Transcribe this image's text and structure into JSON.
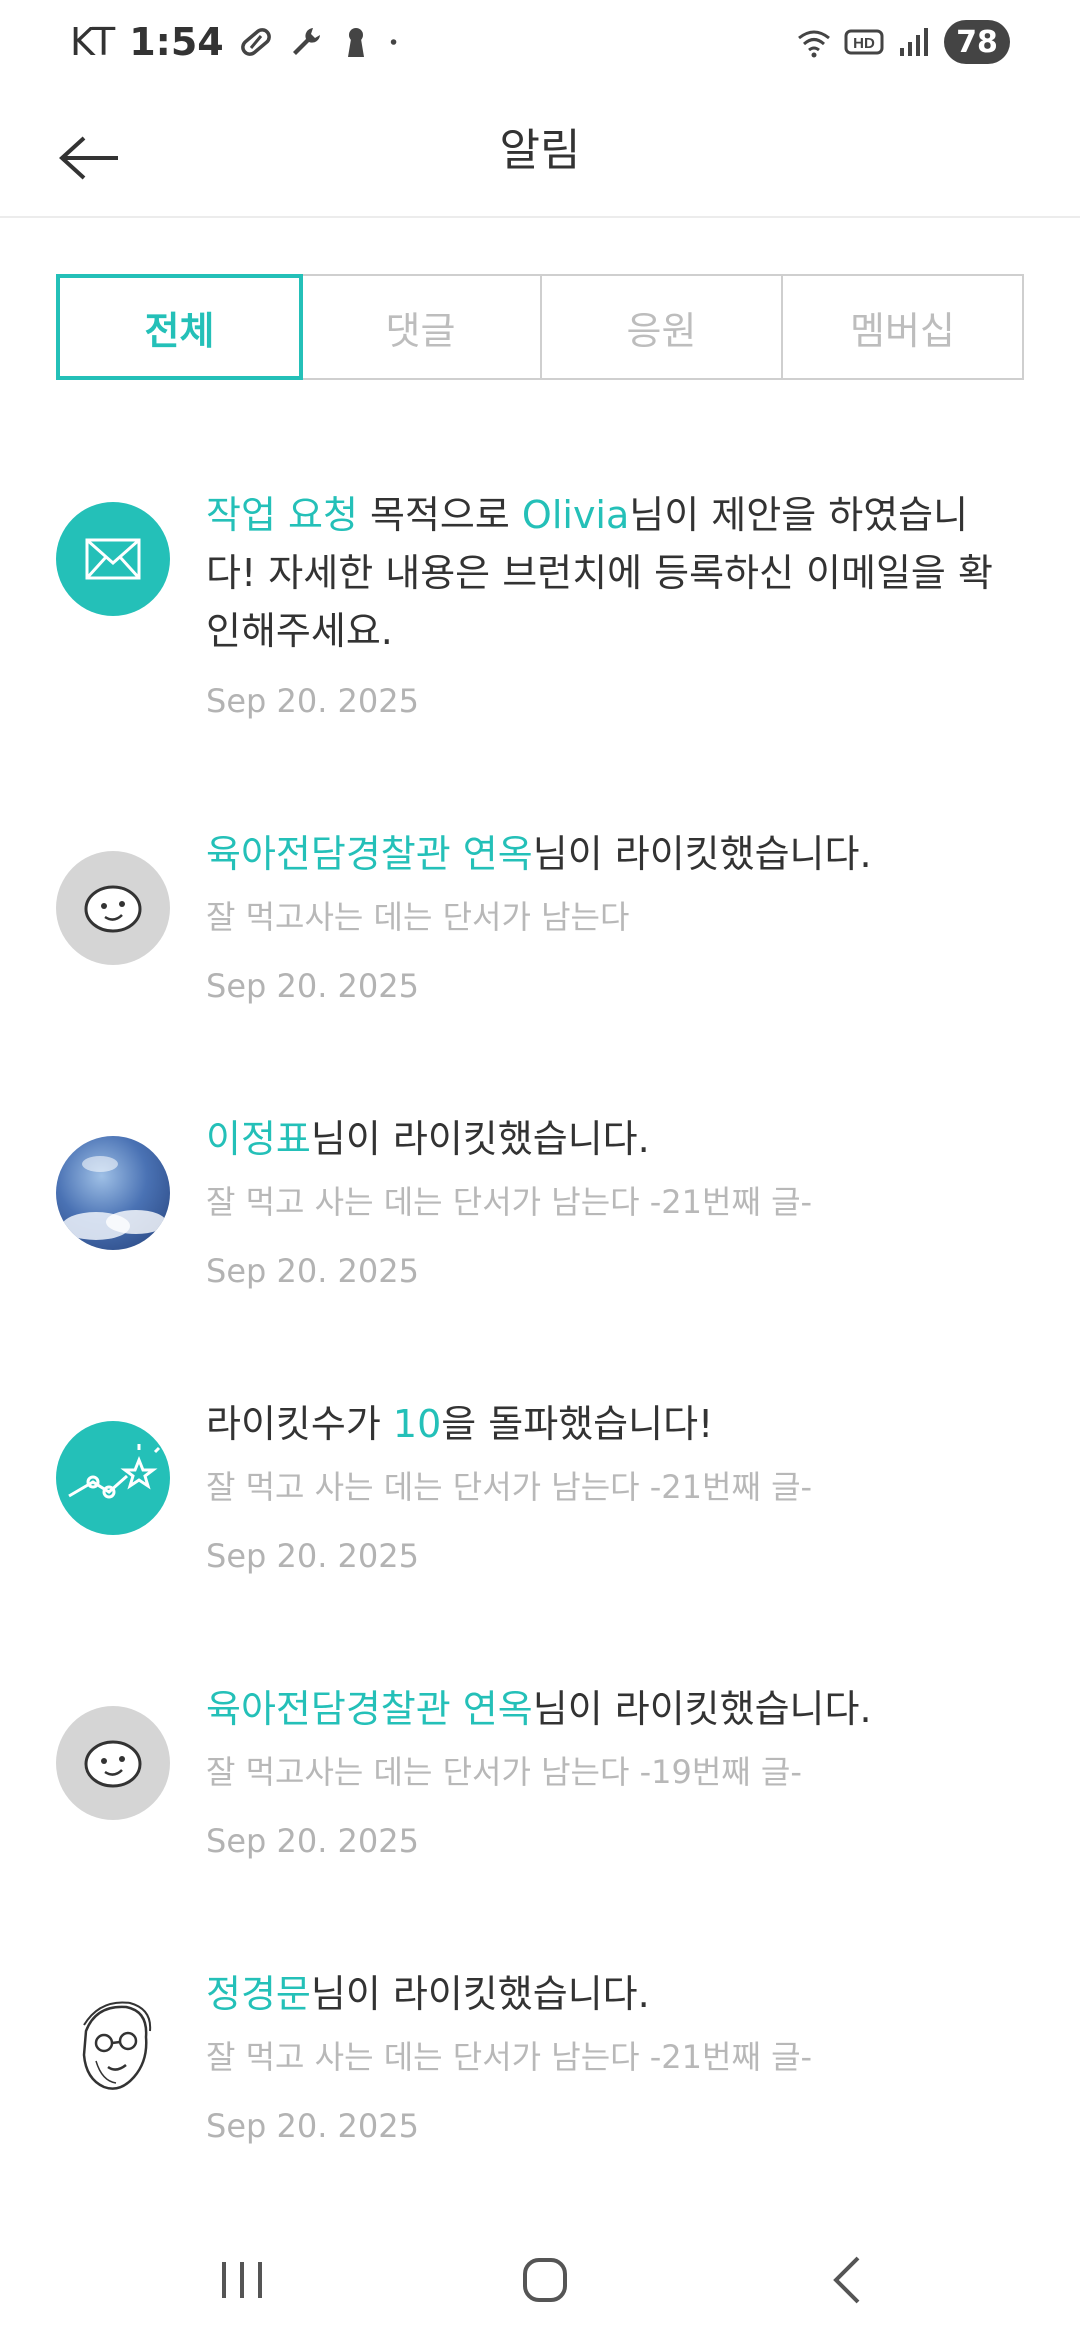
{
  "status_bar": {
    "carrier": "KT",
    "time": "1:54",
    "left_icons": [
      "pill-icon",
      "wrench-icon",
      "keyhole-icon",
      "dot-icon"
    ],
    "right_icons": [
      "wifi-icon",
      "hd-icon",
      "signal-icon"
    ],
    "battery": "78"
  },
  "header": {
    "title": "알림",
    "back_icon": "back-arrow-icon"
  },
  "tabs": [
    {
      "label": "전체",
      "active": true
    },
    {
      "label": "댓글",
      "active": false
    },
    {
      "label": "응원",
      "active": false
    },
    {
      "label": "멤버십",
      "active": false
    }
  ],
  "notifications": [
    {
      "avatar": "envelope-icon",
      "parts": [
        {
          "text": "작업 요청",
          "highlight": true
        },
        {
          "text": " 목적으로 ",
          "highlight": false
        },
        {
          "text": "Olivia",
          "highlight": true
        },
        {
          "text": "님이 제안을 하였습니다!  자세한 내용은 브런치에 등록하신 이메일을 확인해주세요.",
          "highlight": false
        }
      ],
      "subtitle": "",
      "date": "Sep 20. 2025"
    },
    {
      "avatar": "smiley-face-avatar",
      "parts": [
        {
          "text": "육아전담경찰관 연옥",
          "highlight": true
        },
        {
          "text": "님이 라이킷했습니다.",
          "highlight": false
        }
      ],
      "subtitle": "잘 먹고사는 데는 단서가 남는다",
      "date": "Sep 20. 2025"
    },
    {
      "avatar": "sky-photo-avatar",
      "parts": [
        {
          "text": "이정표",
          "highlight": true
        },
        {
          "text": "님이 라이킷했습니다.",
          "highlight": false
        }
      ],
      "subtitle": "잘 먹고 사는 데는 단서가 남는다 -21번째 글-",
      "date": "Sep 20. 2025"
    },
    {
      "avatar": "star-chart-icon",
      "parts": [
        {
          "text": "라이킷수가 ",
          "highlight": false
        },
        {
          "text": "10",
          "highlight": true
        },
        {
          "text": "을 돌파했습니다!",
          "highlight": false
        }
      ],
      "subtitle": "잘 먹고 사는 데는 단서가 남는다 -21번째 글-",
      "date": "Sep 20. 2025"
    },
    {
      "avatar": "smiley-face-avatar",
      "parts": [
        {
          "text": "육아전담경찰관 연옥",
          "highlight": true
        },
        {
          "text": "님이 라이킷했습니다.",
          "highlight": false
        }
      ],
      "subtitle": "잘 먹고사는 데는 단서가 남는다 -19번째 글-",
      "date": "Sep 20. 2025"
    },
    {
      "avatar": "sketch-portrait-avatar",
      "parts": [
        {
          "text": "정경문",
          "highlight": true
        },
        {
          "text": "님이 라이킷했습니다.",
          "highlight": false
        }
      ],
      "subtitle": "잘 먹고 사는 데는 단서가 남는다 -21번째 글-",
      "date": "Sep 20. 2025"
    }
  ],
  "nav_bar": {
    "recents_icon": "recent-apps-icon",
    "home_icon": "home-icon",
    "back_icon": "nav-back-icon"
  },
  "colors": {
    "accent": "#24c0b8",
    "text": "#333333",
    "muted": "#b8b8b8"
  }
}
